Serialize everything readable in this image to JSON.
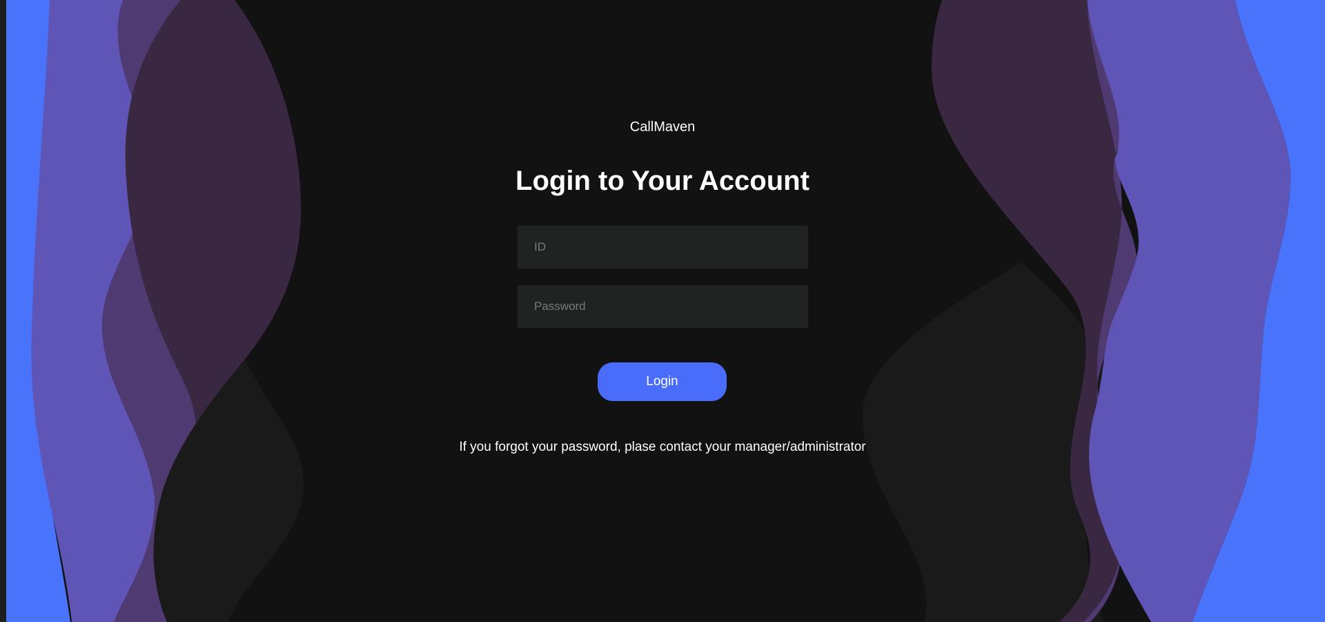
{
  "brand": {
    "name": "CallMaven"
  },
  "login": {
    "title": "Login to Your Account",
    "id_placeholder": "ID",
    "password_placeholder": "Password",
    "submit_label": "Login",
    "help_text": "If you forgot your password, plase contact your manager/administrator"
  },
  "colors": {
    "background": "#121212",
    "accent": "#4a6cfa",
    "input_background": "#212222",
    "wave_blue": "#4a73fb",
    "wave_violet": "#5f55b6",
    "wave_purple": "#4f3a72",
    "wave_plum": "#3a2742"
  }
}
